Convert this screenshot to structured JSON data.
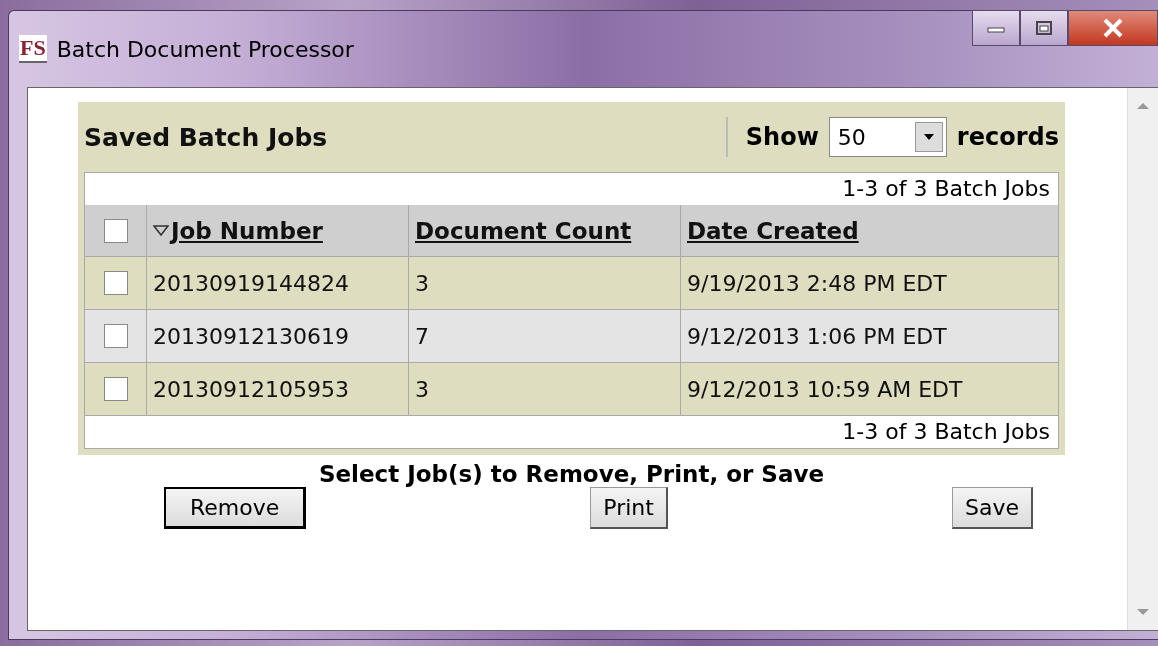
{
  "window": {
    "title": "Batch Document Processor",
    "icon_text": "FS"
  },
  "panel": {
    "title": "Saved Batch Jobs",
    "show_label": "Show",
    "page_size": "50",
    "records_label": "records"
  },
  "pager_top": "1-3 of 3 Batch Jobs",
  "table": {
    "select_all": {
      "checked": false
    },
    "columns": [
      {
        "label": "Job Number",
        "sorted": true
      },
      {
        "label": "Document Count",
        "sorted": false
      },
      {
        "label": "Date Created",
        "sorted": false
      }
    ],
    "rows": [
      {
        "checked": false,
        "cells": [
          "20130919144824",
          "3",
          "9/19/2013 2:48 PM EDT"
        ]
      },
      {
        "checked": false,
        "cells": [
          "20130912130619",
          "7",
          "9/12/2013 1:06 PM EDT"
        ]
      },
      {
        "checked": false,
        "cells": [
          "20130912105953",
          "3",
          "9/12/2013 10:59 AM EDT"
        ]
      }
    ]
  },
  "pager_bottom": "1-3 of 3 Batch Jobs",
  "instruction": "Select Job(s) to Remove, Print, or Save",
  "buttons": [
    {
      "label": "Remove",
      "focused": true
    },
    {
      "label": "Print",
      "focused": false
    },
    {
      "label": "Save",
      "focused": false
    }
  ]
}
